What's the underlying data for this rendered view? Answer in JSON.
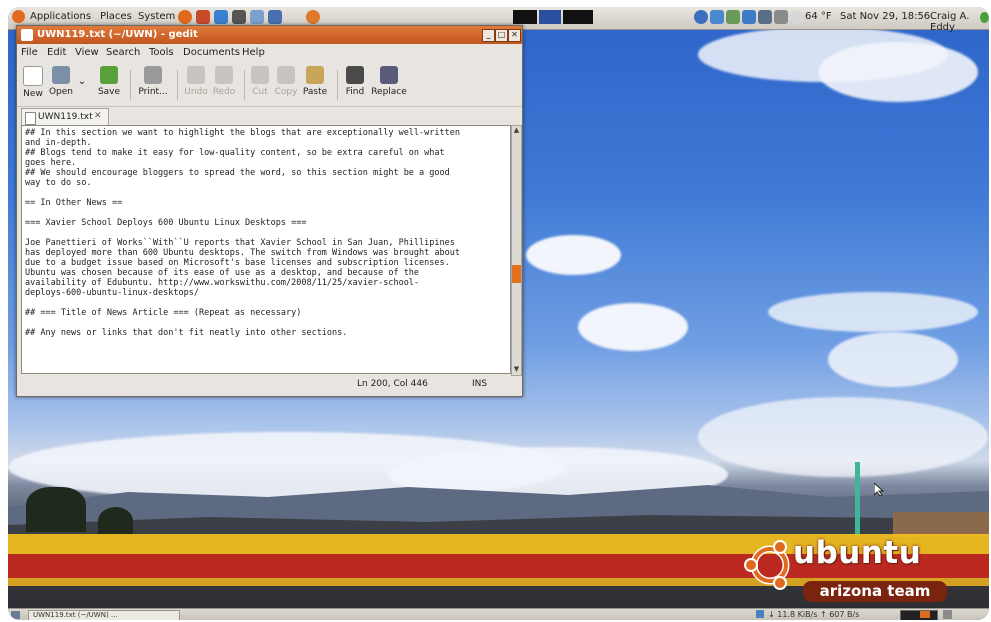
{
  "top_panel": {
    "menus": [
      "Applications",
      "Places",
      "System"
    ],
    "weather": "64 °F",
    "datetime": "Sat Nov 29, 18:56",
    "user": "Craig A. Eddy"
  },
  "window": {
    "title": "UWN119.txt (~/UWN) - gedit",
    "menubar": [
      "File",
      "Edit",
      "View",
      "Search",
      "Tools",
      "Documents",
      "Help"
    ],
    "toolbar": [
      {
        "label": "New",
        "icon": "new-document-icon",
        "enabled": true
      },
      {
        "label": "Open",
        "icon": "open-folder-icon",
        "enabled": true
      },
      {
        "label": "Save",
        "icon": "save-icon",
        "enabled": true
      },
      {
        "label": "Print...",
        "icon": "printer-icon",
        "enabled": true
      },
      {
        "label": "Undo",
        "icon": "undo-icon",
        "enabled": false
      },
      {
        "label": "Redo",
        "icon": "redo-icon",
        "enabled": false
      },
      {
        "label": "Cut",
        "icon": "scissors-icon",
        "enabled": false
      },
      {
        "label": "Copy",
        "icon": "copy-icon",
        "enabled": false
      },
      {
        "label": "Paste",
        "icon": "paste-icon",
        "enabled": true
      },
      {
        "label": "Find",
        "icon": "binoculars-icon",
        "enabled": true
      },
      {
        "label": "Replace",
        "icon": "replace-icon",
        "enabled": true
      }
    ],
    "tab_label": "UWN119.txt",
    "lines": [
      "## In this section we want to highlight the blogs that are exceptionally well-written",
      "and in-depth.",
      "## Blogs tend to make it easy for low-quality content, so be extra careful on what",
      "goes here.",
      "## We should encourage bloggers to spread the word, so this section might be a good",
      "way to do so.",
      "",
      "== In Other News ==",
      "",
      "=== Xavier School Deploys 600 Ubuntu Linux Desktops ===",
      "",
      "Joe Panettieri of Works``With``U reports that Xavier School in San Juan, Phillipines",
      "has deployed more than 600 Ubuntu desktops. The switch from Windows was brought about",
      "due to a budget issue based on Microsoft's base licenses and subscription licenses.",
      "Ubuntu was chosen because of its ease of use as a desktop, and because of the",
      "availability of Edubuntu. http://www.workswithu.com/2008/11/25/xavier-school-",
      "deploys-600-ubuntu-linux-desktops/",
      "",
      "## === Title of News Article === (Repeat as necessary)",
      "",
      "## Any news or links that don't fit neatly into other sections.",
      ""
    ],
    "status": {
      "position": "Ln 200, Col 446",
      "mode": "INS"
    }
  },
  "wallpaper": {
    "logo_word": "ubuntu",
    "logo_sub": "arizona team"
  },
  "bottom_panel": {
    "task": "UWN119.txt (~/UWN) ...",
    "net_speed": "↓ 11.8 KiB/s ↑ 607 B/s"
  },
  "colors": {
    "title_orange": "#d3652b",
    "scroll_thumb": "#e2711d",
    "stripe_yellow": "#f2be1e",
    "stripe_red": "#ca281e"
  }
}
